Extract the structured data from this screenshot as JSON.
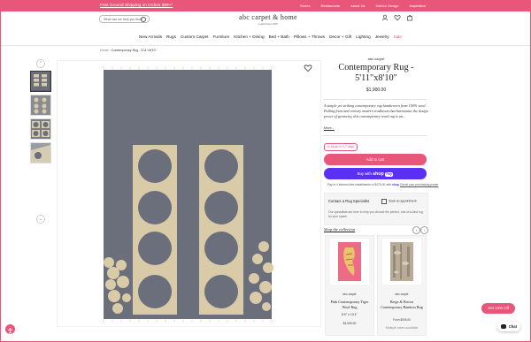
{
  "topbar": {
    "promo": "Free Ground Shipping on Orders $99+*",
    "links": [
      "Stores",
      "Restaurants",
      "About Us",
      "Interior Design",
      "Inspiration"
    ]
  },
  "header": {
    "search_placeholder": "What can we help you find?",
    "logo_name": "abc carpet & home",
    "logo_est": "established 1897"
  },
  "nav": {
    "items": [
      "New Arrivals",
      "Rugs",
      "Custom Carpet",
      "Furniture",
      "Kitchen + Dining",
      "Bed + Bath",
      "Pillows + Throws",
      "Decor + Gift",
      "Lighting",
      "Jewelry"
    ],
    "sale": "Sale"
  },
  "breadcrumb": {
    "home": "Home",
    "current": "Contemporary Rug - 5'11\"x8'10\""
  },
  "product": {
    "brand": "abc carpet",
    "title": "Contemporary Rug - 5'11\"x8'10\"",
    "price": "$1,900.00",
    "description": "A simple yet striking contemporary rug handwoven from 100% wool. Pulling from mid century modern traditions that harmonize the design power of geometry, this contemporary wool rug is an...",
    "more": "More...",
    "stock": "In Stock In 3-7 days",
    "add_to_cart": "Add to cart",
    "buy_with": "Buy with",
    "shop": "shop",
    "pay": "Pay",
    "installments_prefix": "Pay in 4 interest-free installments of",
    "installments_amount": "$475.00",
    "installments_with": "with",
    "installments_link": "Check your purchasing power"
  },
  "specialist": {
    "heading": "Contact a Rug Specialist",
    "appointment": "Book an appointment",
    "text": "Our specialists are here to help you choose the perfect, one-of-a-kind rug for your space."
  },
  "collection": {
    "heading": "Shop the collection",
    "cards": [
      {
        "brand": "abc carpet",
        "name": "Pink Contemporary Tiger Wool Rug",
        "size": "6'0\" x 10'1\"",
        "price": "$4,900.00"
      },
      {
        "brand": "abc carpet",
        "name": "Beige & Brown Contemporary Bamboo Rug",
        "from": "From $905.00",
        "multi": "Multiple sizes available"
      }
    ]
  },
  "widgets": {
    "promo": "Get 10% Off",
    "chat": "Chat"
  },
  "colors": {
    "accent": "#e8577a",
    "shoppay": "#5a31f4",
    "rug_ground": "#6b6f7b",
    "rug_motif": "#d9cba8"
  }
}
